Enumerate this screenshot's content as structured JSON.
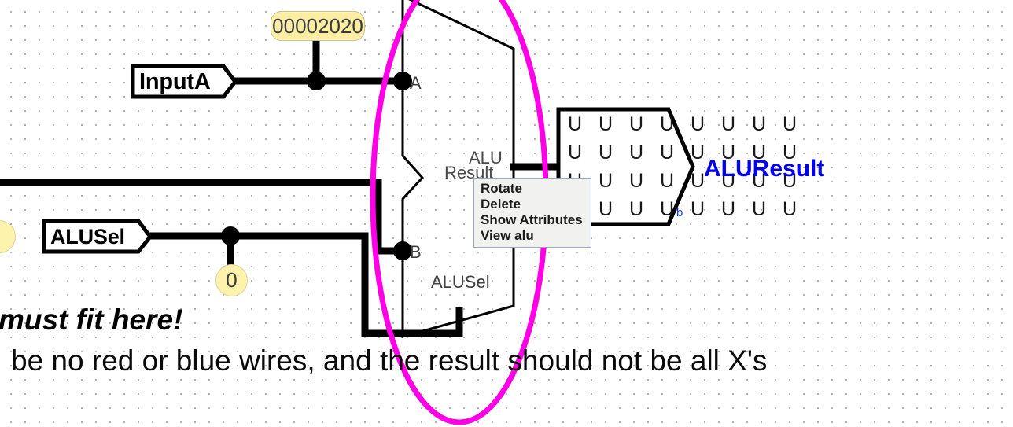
{
  "app": {
    "kind": "logisim-circuit-canvas",
    "background": "#ffffff",
    "grid_color": "#9a9a9a"
  },
  "colors": {
    "wire": "#000000",
    "highlight_ellipse": "#ff00e6",
    "probe_label": "#0000f0",
    "value_pill_fill": "#fbeda2",
    "value_bubble_fill": "#fdf3ad",
    "menu_bg": "#f1f1f0",
    "menu_border": "#9aa7bb"
  },
  "pins": [
    {
      "name": "input-pin-a",
      "label": "InputA"
    },
    {
      "name": "input-pin-alusel",
      "label": "ALUSel"
    }
  ],
  "values": [
    {
      "name": "wire-value-inputa",
      "text": "00002020",
      "shape": "pill"
    },
    {
      "name": "wire-value-alusel",
      "text": "0",
      "shape": "bubble"
    }
  ],
  "alu": {
    "name": "alu-component",
    "caption_line1": "ALU",
    "caption_line2": "Result",
    "ports": [
      {
        "name": "alu-port-a",
        "label": "A"
      },
      {
        "name": "alu-port-b",
        "label": "B"
      },
      {
        "name": "alu-port-alusel",
        "label": "ALUSel"
      }
    ]
  },
  "probe": {
    "name": "output-probe",
    "bit_rows": [
      "U U U U U U U U",
      "U U U U U U U U",
      "U U U U U U U U",
      "U U U U U U U U"
    ],
    "radix": "b",
    "output_label": "ALUResult"
  },
  "context_menu": {
    "name": "alu-context-menu",
    "items": [
      {
        "name": "menu-item-rotate",
        "label": "Rotate"
      },
      {
        "name": "menu-item-delete",
        "label": "Delete"
      },
      {
        "name": "menu-item-show-attributes",
        "label": "Show Attributes"
      },
      {
        "name": "menu-item-view-alu",
        "label": "View alu"
      }
    ]
  },
  "notes": {
    "line_bold": "must fit here!",
    "line_plain": "be no red or blue wires, and the result should not be all X's"
  }
}
